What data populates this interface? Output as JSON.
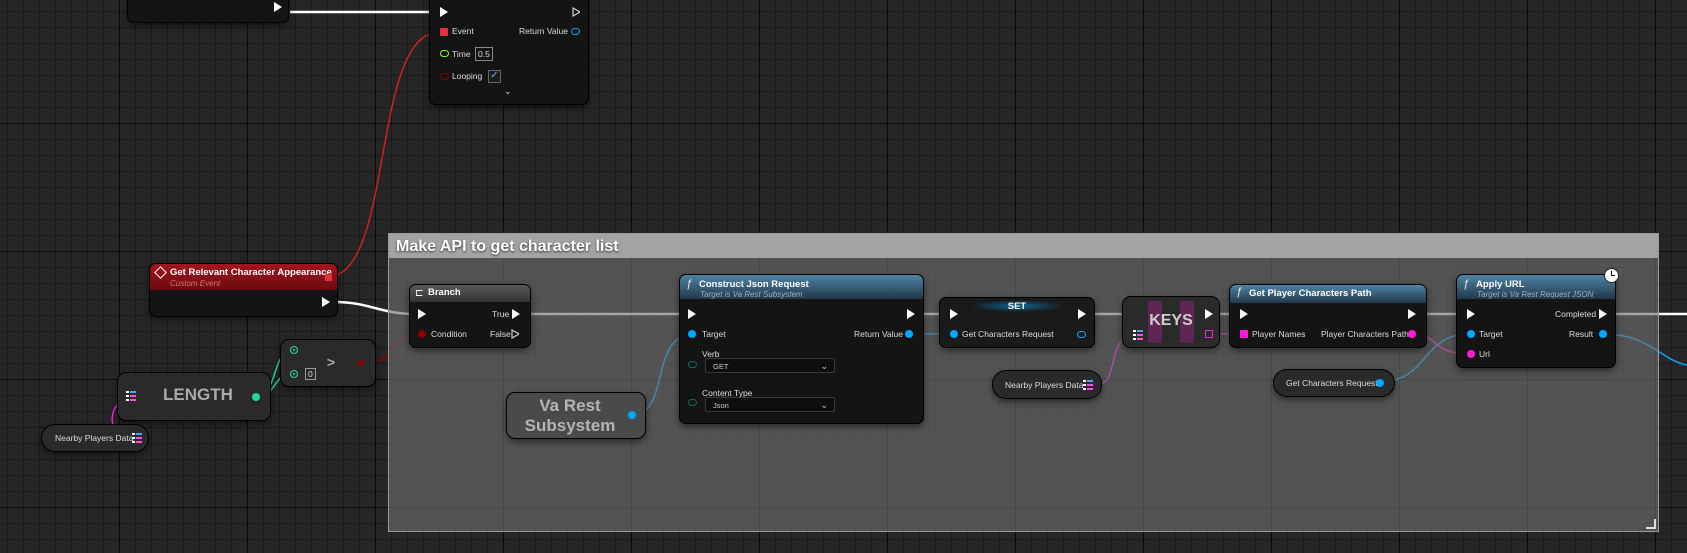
{
  "timer_node": {
    "pin_event": "Event",
    "pin_time": "Time",
    "time_value": "0.5",
    "pin_looping": "Looping",
    "pin_return": "Return Value"
  },
  "custom_event": {
    "title": "Get Relevant Character Appearance",
    "subtitle": "Custom Event"
  },
  "length_node": {
    "title": "LENGTH"
  },
  "nearby_players_left": {
    "label": "Nearby Players Data"
  },
  "greater_node": {
    "operator": ">",
    "value_b": "0"
  },
  "comment_box": {
    "title": "Make API to get character list"
  },
  "branch": {
    "title": "Branch",
    "pin_condition": "Condition",
    "pin_true": "True",
    "pin_false": "False"
  },
  "va_rest_subsystem": {
    "line1": "Va Rest",
    "line2": "Subsystem"
  },
  "construct_json": {
    "title": "Construct Json Request",
    "subtitle": "Target is Va Rest Subsystem",
    "pin_target": "Target",
    "pin_return": "Return Value",
    "verb_label": "Verb",
    "verb_value": "GET",
    "content_type_label": "Content Type",
    "content_type_value": "Json"
  },
  "set_node": {
    "title": "SET",
    "pin_var": "Get Characters Request"
  },
  "keys_node": {
    "title": "KEYS"
  },
  "nearby_players_mid": {
    "label": "Nearby Players Data"
  },
  "get_player_chars": {
    "title": "Get Player Characters Path",
    "pin_in": "Player Names",
    "pin_out": "Player Characters Path"
  },
  "get_chars_request": {
    "label": "Get Characters Request"
  },
  "apply_url": {
    "title": "Apply URL",
    "subtitle": "Target is Va Rest Request JSON",
    "pin_completed": "Completed",
    "pin_target": "Target",
    "pin_result": "Result",
    "pin_url": "Url"
  },
  "colors": {
    "exec": "#ffffff",
    "boolean": "#8b0000",
    "object": "#00a8ff",
    "string": "#ff1bd4",
    "integer": "#1bdca0",
    "event_red": "#e0343a"
  }
}
